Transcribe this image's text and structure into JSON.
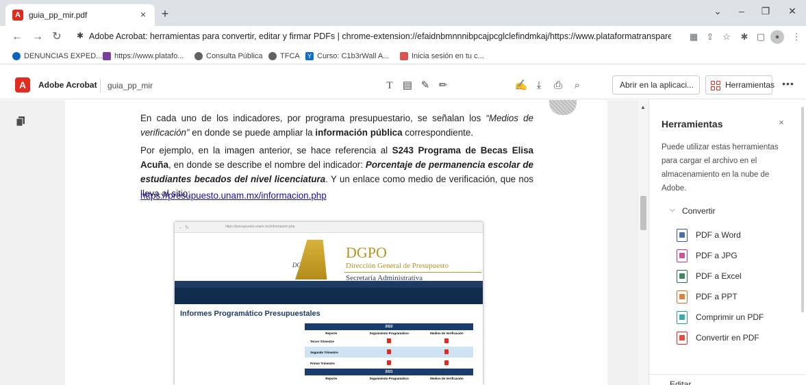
{
  "browser": {
    "tab": {
      "title": "guia_pp_mir.pdf",
      "close": "×"
    },
    "new_tab": "+",
    "window_controls": {
      "minimize": "–",
      "restore": "❐",
      "close": "✕",
      "collapse": "⌄"
    },
    "address": "Adobe Acrobat: herramientas para convertir, editar y firmar PDFs  |  chrome-extension://efaidnbmnnnibpcajpcglclefindmkaj/https://www.plataformatranspare...",
    "bookmarks": [
      {
        "label": "DENUNCIAS EXPED...",
        "icon": "cloud-icon",
        "color": "#0a66c2"
      },
      {
        "label": "https://www.platafo...",
        "icon": "site-icon",
        "color": "#7b3fa0"
      },
      {
        "label": "Consulta Pública",
        "icon": "globe-icon",
        "color": "#5f6368"
      },
      {
        "label": "TFCA",
        "icon": "globe-icon",
        "color": "#5f6368"
      },
      {
        "label": "Curso: C1b3rWall A...",
        "icon": "yahoo-icon",
        "color": "#0e6fc7"
      },
      {
        "label": "Inicia sesión en tu c...",
        "icon": "office-icon",
        "color": "#d9534f"
      }
    ]
  },
  "acrobat": {
    "brand": "Adobe Acrobat",
    "filename": "guia_pp_mir",
    "open_in_app": "Abrir en la aplicaci...",
    "tools_button": "Herramientas",
    "more": "•••"
  },
  "document": {
    "p1_a": "En cada uno de los indicadores, por programa presupuestario, se señalan los ",
    "p1_b": "“Medios de verificación”",
    "p1_c": " en donde se puede ampliar la ",
    "p1_d": "información pública",
    "p1_e": " correspondiente.",
    "p2_a": "Por ejemplo, en la imagen anterior, se hace referencia al ",
    "p2_b": "S243 Programa de Becas Elisa Acuña",
    "p2_c": ", en donde se describe el nombre del indicador: ",
    "p2_d": "Porcentaje de permanencia escolar de estudiantes becados del nivel licenciatura",
    "p2_e": ". Y un enlace como medio de verificación, que nos lleva al sitio:",
    "link": "https://presupuesto.unam.mx/informacion.php"
  },
  "embedded_page": {
    "url": "https://presupuesto.unam.mx/informacion.php",
    "logo_small": "DGPO",
    "title": "DGPO",
    "subtitle1": "Dirección General de Presupuesto",
    "subtitle2": "Secretaría Administrativa",
    "heading": "Informes Programático Presupuestales",
    "year1": "2022",
    "year2": "2021",
    "col_reporte": "Reporte",
    "col_seguimiento": "Seguimiento Programático",
    "col_medios": "Medios de Verificación",
    "rows": [
      "Tercer Trimestre",
      "Segundo Trimestre",
      "Primer Trimestre"
    ]
  },
  "panel": {
    "title": "Herramientas",
    "close": "×",
    "description": "Puede utilizar estas herramientas para cargar el archivo en el almacenamiento en la nube de Adobe.",
    "section": "Convertir",
    "tools": [
      {
        "label": "PDF a Word",
        "icon": "word-icon",
        "color": "#2b5797"
      },
      {
        "label": "PDF a JPG",
        "icon": "jpg-icon",
        "color": "#c7358a"
      },
      {
        "label": "PDF a Excel",
        "icon": "excel-icon",
        "color": "#1e7145"
      },
      {
        "label": "PDF a PPT",
        "icon": "ppt-icon",
        "color": "#d86c1e"
      },
      {
        "label": "Comprimir un PDF",
        "icon": "compress-icon",
        "color": "#1a9ba3"
      },
      {
        "label": "Convertir en PDF",
        "icon": "convert-icon",
        "color": "#e22b1c"
      }
    ],
    "next_section": "Editar"
  }
}
